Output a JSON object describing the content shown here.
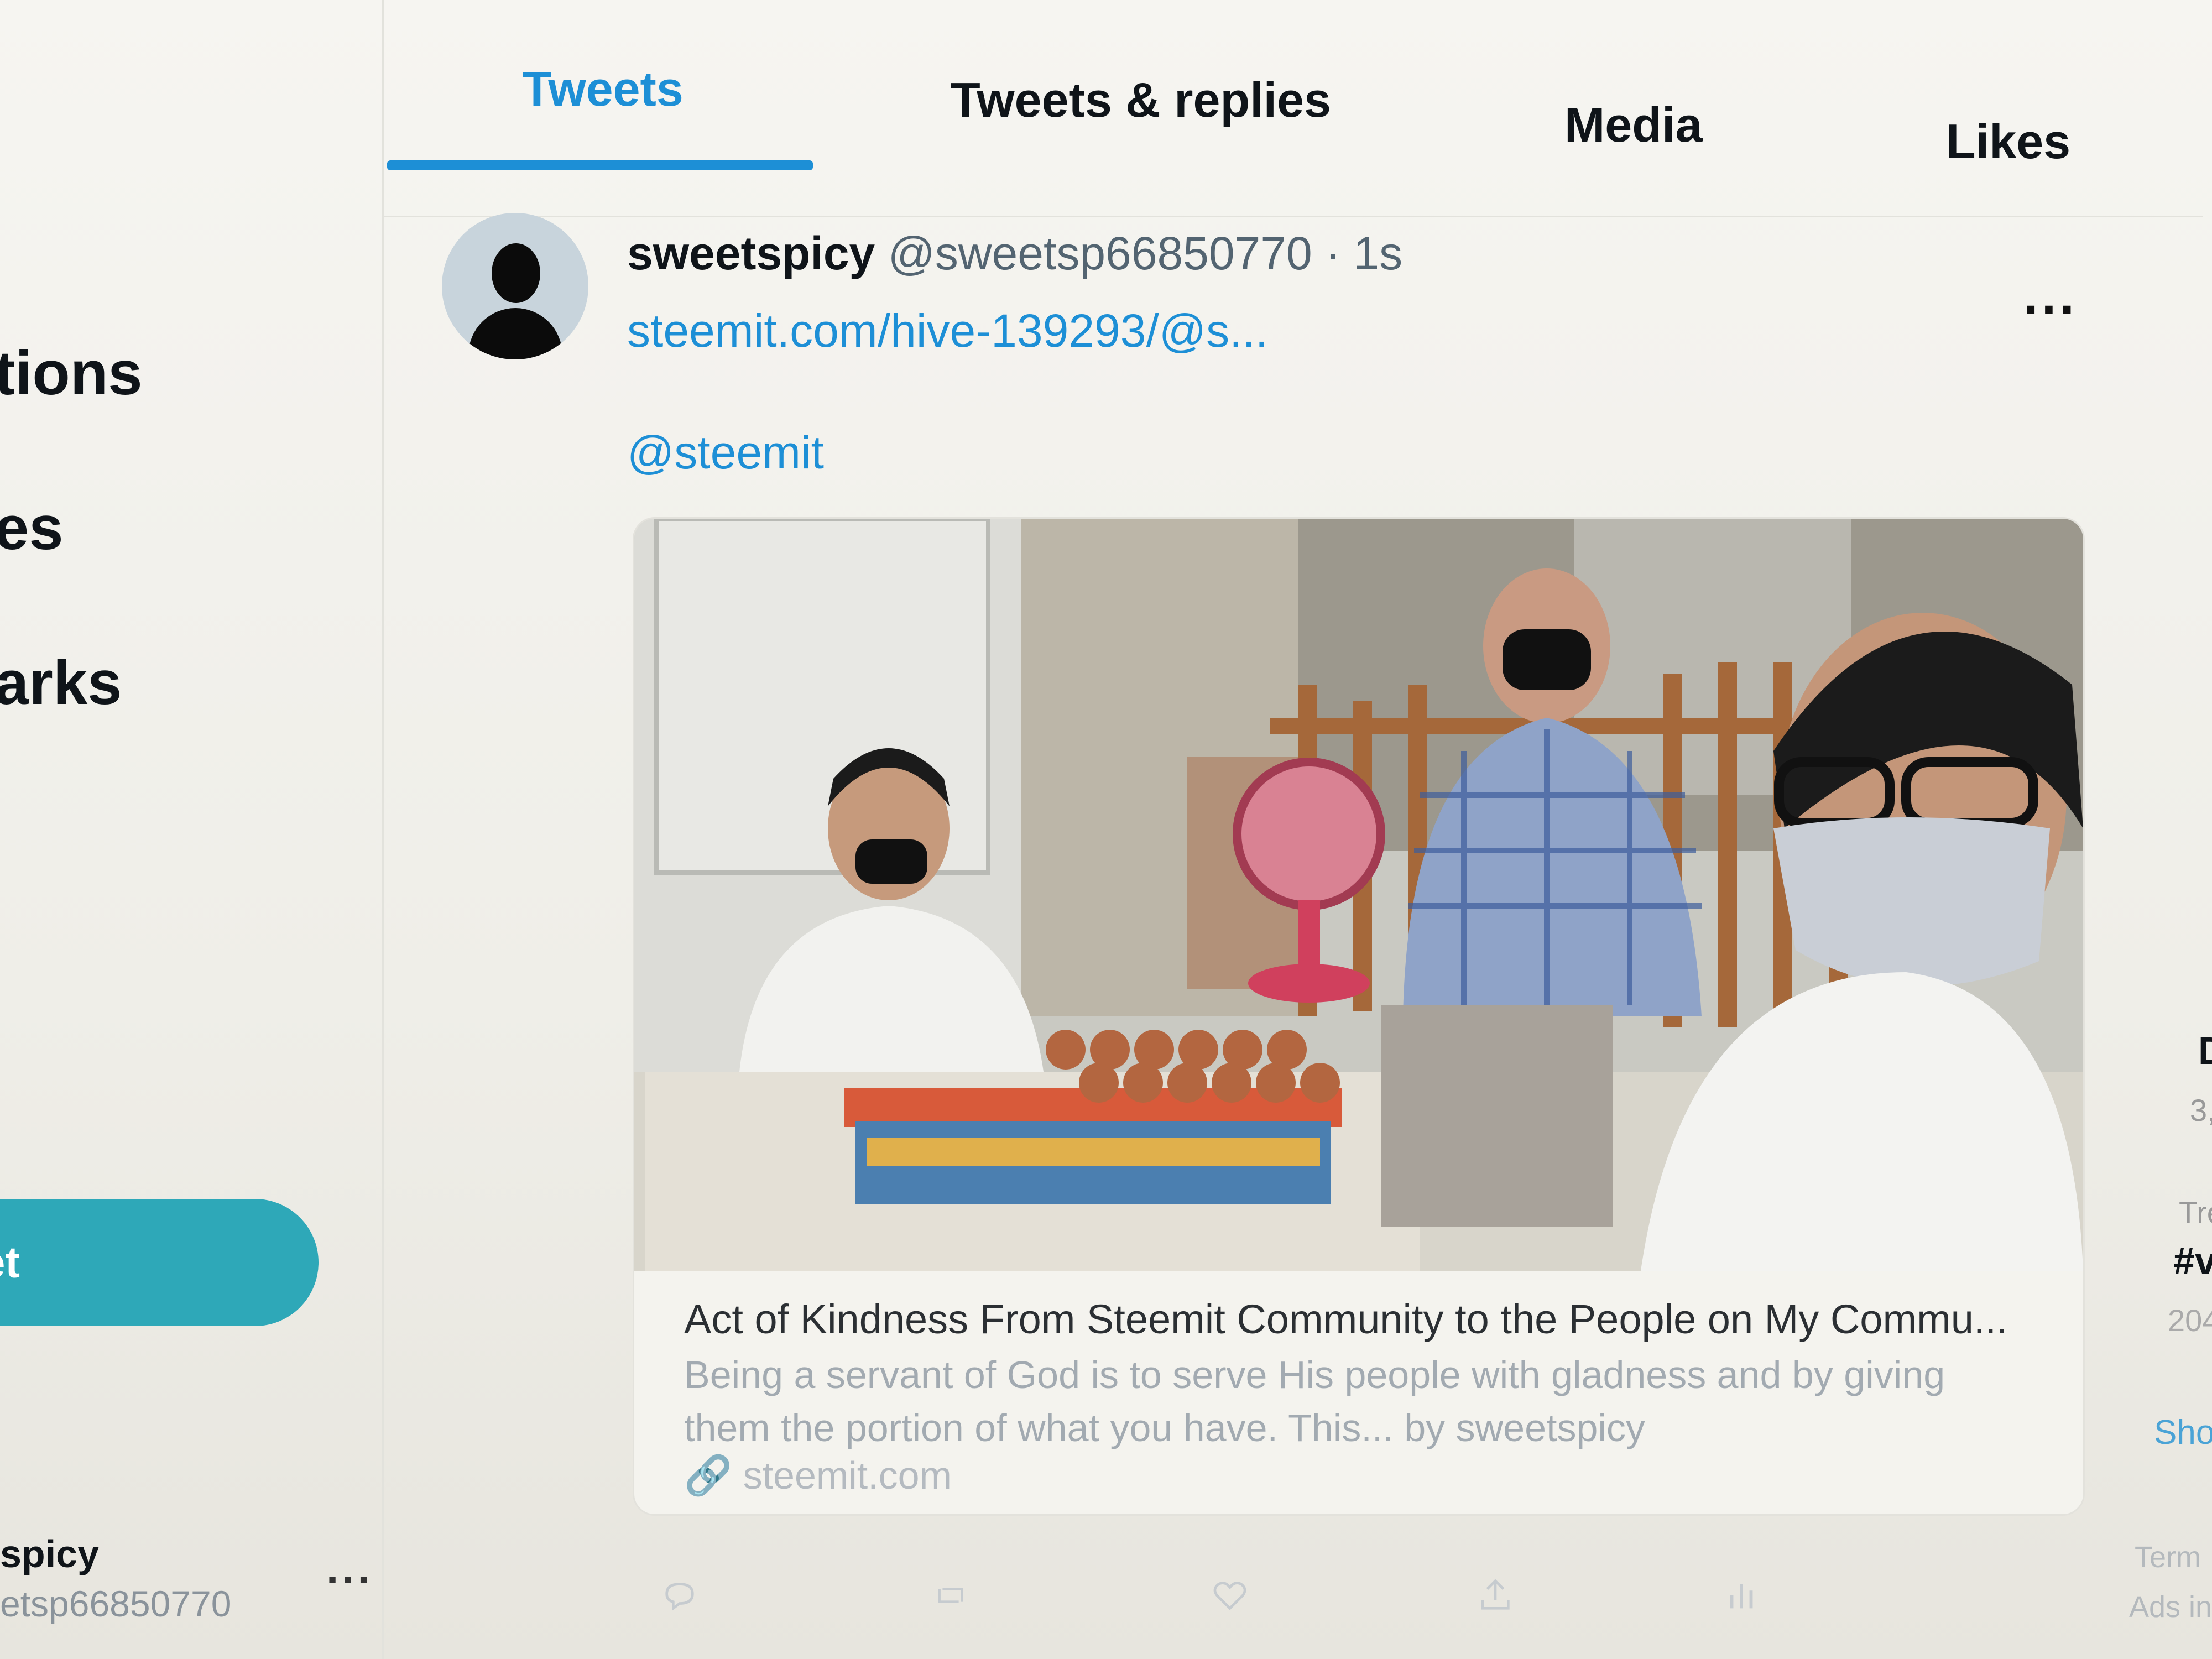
{
  "sidebar": {
    "items": [
      {
        "label": "tions"
      },
      {
        "label": "es"
      },
      {
        "label": "arks"
      }
    ],
    "tweet_button_label": "eet",
    "account": {
      "name": "spicy",
      "handle": "etsp66850770",
      "more": "..."
    }
  },
  "tabs": [
    {
      "label": "Tweets",
      "active": true
    },
    {
      "label": "Tweets & replies",
      "active": false
    },
    {
      "label": "Media",
      "active": false
    },
    {
      "label": "Likes",
      "active": false
    }
  ],
  "tweet": {
    "display_name": "sweetspicy",
    "handle_time": "@sweetsp66850770 · 1s",
    "more": "...",
    "link": "steemit.com/hive-139293/@s...",
    "mention": "@steemit",
    "card": {
      "title": "Act of Kindness From Steemit Community to the People on My Commu...",
      "description": "Being a servant of God is to serve His people with gladness and by giving them the portion of what you have. This... by sweetspicy",
      "domain": "steemit.com"
    }
  },
  "right_sidebar": {
    "items": [
      "D",
      "3,",
      "Tre",
      "#v",
      "204",
      "Sho",
      "Term",
      "Ads in"
    ]
  },
  "colors": {
    "accent": "#1d8fd6",
    "tweet_button": "#2ea8b8"
  }
}
